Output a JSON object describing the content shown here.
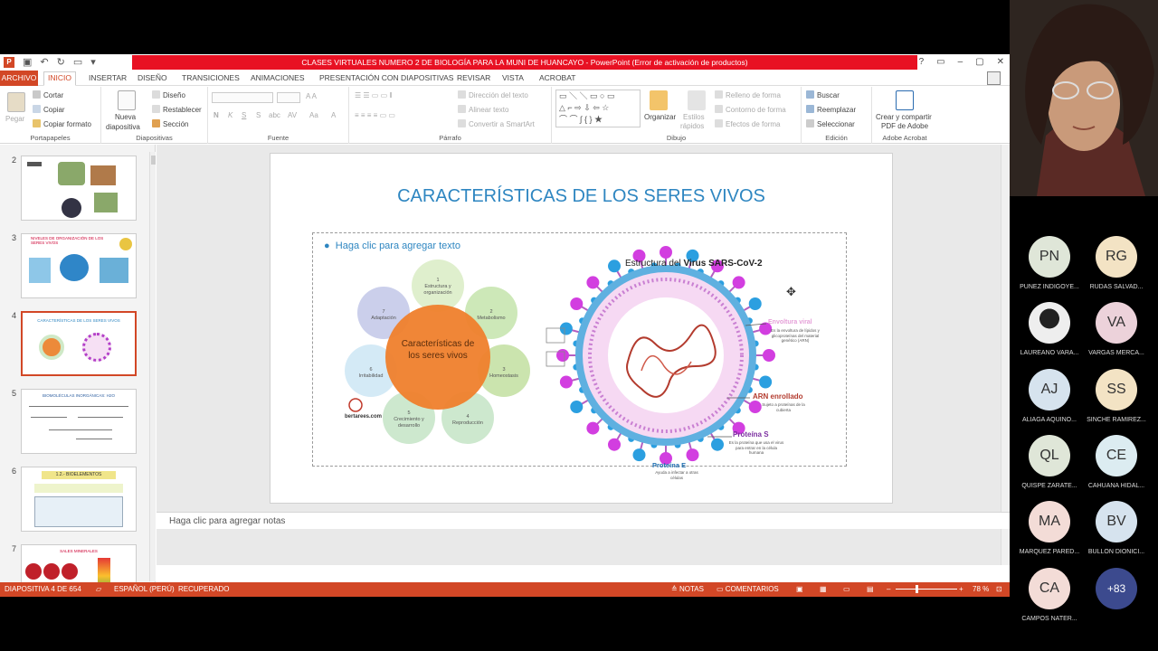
{
  "window": {
    "title": "CLASES VIRTUALES  NUMERO 2 DE BIOLOGÍA PARA LA MUNI DE HUANCAYO -  PowerPoint (Error de activación de productos)",
    "controls": [
      "?",
      "▭",
      "–",
      "▢",
      "✕"
    ]
  },
  "tabs": [
    "ARCHIVO",
    "INICIO",
    "INSERTAR",
    "DISEÑO",
    "TRANSICIONES",
    "ANIMACIONES",
    "PRESENTACIÓN CON DIAPOSITIVAS",
    "REVISAR",
    "VISTA",
    "ACROBAT"
  ],
  "ribbon": {
    "clipboard": {
      "paste": "Pegar",
      "cut": "Cortar",
      "copy": "Copiar",
      "format_painter": "Copiar formato",
      "label": "Portapapeles"
    },
    "slides": {
      "new_slide": "Nueva",
      "new_slide2": "diapositiva",
      "layout": "Diseño",
      "reset": "Restablecer",
      "section": "Sección",
      "label": "Diapositivas"
    },
    "font": {
      "bold": "N",
      "italic": "K",
      "underline": "S",
      "strike": "S",
      "shadow": "abc",
      "spacing": "AV",
      "case": "Aa",
      "color": "A",
      "label": "Fuente"
    },
    "paragraph": {
      "direction": "Dirección del texto",
      "align": "Alinear texto",
      "smartart": "Convertir a SmartArt",
      "label": "Párrafo"
    },
    "drawing": {
      "arrange": "Organizar",
      "quick_styles": "Estilos",
      "quick_styles2": "rápidos",
      "fill": "Relleno de forma",
      "outline": "Contorno de forma",
      "effects": "Efectos de forma",
      "label": "Dibujo"
    },
    "editing": {
      "find": "Buscar",
      "replace": "Reemplazar",
      "select": "Seleccionar",
      "label": "Edición"
    },
    "acrobat": {
      "create": "Crear y compartir",
      "create2": "PDF de Adobe",
      "label": "Adobe Acrobat"
    }
  },
  "thumbnails": [
    {
      "num": "2"
    },
    {
      "num": "3",
      "title": "NIVELES DE ORGANIZACIÓN DE LOS SERES VIVOS"
    },
    {
      "num": "4",
      "title": "CARACTERÍSTICAS DE LOS SERES VIVOS"
    },
    {
      "num": "5",
      "title": "BIOMOLÉCULAS INORGÁNICAS: H2O"
    },
    {
      "num": "6",
      "title": "1.2.- BIOELEMENTOS"
    },
    {
      "num": "7",
      "title": "SALES MINERALES"
    }
  ],
  "slide": {
    "title": "CARACTERÍSTICAS DE LOS SERES VIVOS",
    "placeholder": "Haga clic para agregar texto",
    "diagram": {
      "center": "Características de los seres vivos",
      "petals": [
        {
          "num": "1",
          "label": "Estructura y organización"
        },
        {
          "num": "2",
          "label": "Metabolismo"
        },
        {
          "num": "3",
          "label": "Homeostasis"
        },
        {
          "num": "4",
          "label": "Reproducción"
        },
        {
          "num": "5",
          "label": "Crecimiento y desarrollo"
        },
        {
          "num": "6",
          "label": "Irritabilidad"
        },
        {
          "num": "7",
          "label": "Adaptación"
        }
      ],
      "source": "bertarees.com"
    },
    "virus": {
      "title_prefix": "Estructura del ",
      "title_bold": "Virus SARS-CoV-2",
      "envelope": "Envoltura viral",
      "envelope_desc": "Es la envoltura de lípidos y glicoproteínas del material genético (ARN)",
      "rna": "ARN enrollado",
      "rna_desc": "Sujeto a proteínas de la cubierta",
      "protein_s": "Proteína S",
      "protein_s_desc": "Es la proteína que usa el virus para entrar en la célula humana",
      "protein_e": "Proteína E",
      "protein_e_desc": "Ayuda a infectar a otras células"
    }
  },
  "notes": "Haga clic para agregar notas",
  "status": {
    "slide": "DIAPOSITIVA 4 DE 654",
    "language": "ESPAÑOL (PERÚ)",
    "recovered": "RECUPERADO",
    "notes": "NOTAS",
    "comments": "COMENTARIOS",
    "zoom": "78 %"
  },
  "participants": [
    {
      "initials": "PN",
      "name": "PUÑEZ INDIGOYE...",
      "color": "#dfe6d8"
    },
    {
      "initials": "RG",
      "name": "RUDAS  SALVAD...",
      "color": "#f3e3c4"
    },
    {
      "initials": "",
      "name": "LAUREANO VARA...",
      "color": "#f0f0f0"
    },
    {
      "initials": "VA",
      "name": "VARGAS MERCA...",
      "color": "#ecd2da"
    },
    {
      "initials": "AJ",
      "name": "ALIAGA AQUINO...",
      "color": "#d6e3ee"
    },
    {
      "initials": "SS",
      "name": "SINCHE RAMÍREZ...",
      "color": "#f3e3c4"
    },
    {
      "initials": "QL",
      "name": "QUISPE ZARATE...",
      "color": "#dfe6d8"
    },
    {
      "initials": "CE",
      "name": "CAHUANA HIDAL...",
      "color": "#dcecf1"
    },
    {
      "initials": "MA",
      "name": "MARQUEZ PARED...",
      "color": "#f3dcd7"
    },
    {
      "initials": "BV",
      "name": "BULLON DIONICI...",
      "color": "#d6e3ee"
    },
    {
      "initials": "CA",
      "name": "CAMPOS NATER...",
      "color": "#f3dcd7"
    },
    {
      "initials": "+83",
      "name": "",
      "color": "#3c4a8e"
    }
  ]
}
